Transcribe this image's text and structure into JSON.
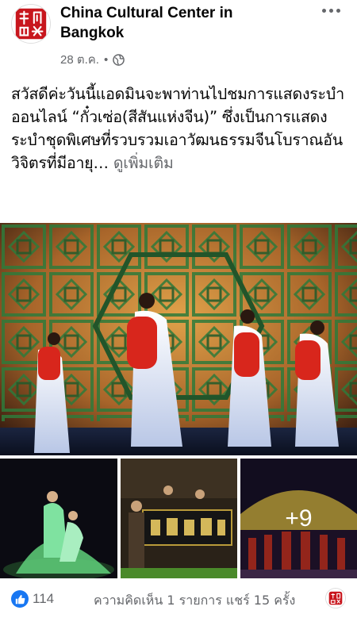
{
  "post": {
    "page_name": "China Cultural Center in Bangkok",
    "timestamp": "28 ต.ค.",
    "separator": "•",
    "privacy_icon": "globe-icon",
    "text": "สวัสดีค่ะวันนี้แอดมินจะพาท่านไปชมการแสดงระบำออนไลน์ “กั๋วเซ่อ(สีสันแห่งจีน)” ซึ่งเป็นการแสดงระบำชุดพิเศษที่รวบรวมเอาวัฒนธรรมจีนโบราณอันวิจิตรที่มีอายุ…",
    "see_more": "ดูเพิ่มเติม",
    "more_photos_label": "+9"
  },
  "footer": {
    "like_count": "114",
    "stats": "ความคิดเห็น 1 รายการ แชร์ 15 ครั้ง"
  },
  "colors": {
    "like_blue": "#1877f2",
    "secondary_text": "#65676b",
    "logo_red": "#c8161d"
  }
}
